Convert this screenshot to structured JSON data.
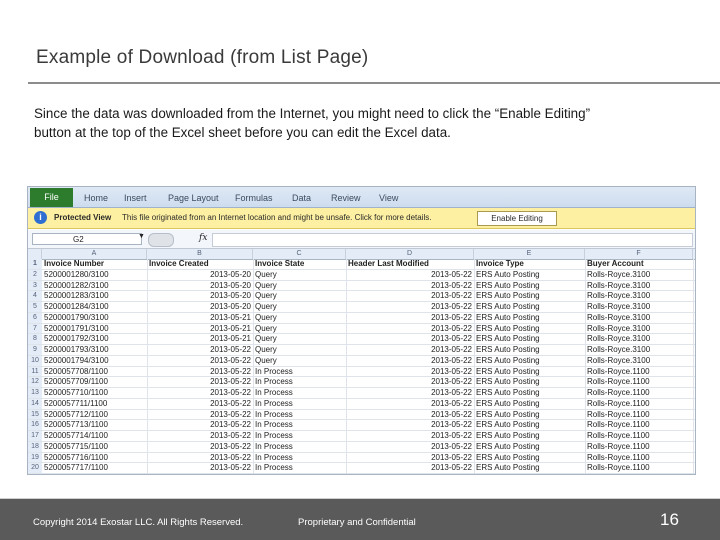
{
  "slide": {
    "title": "Example of Download (from List Page)",
    "intro_line1": "Since the data was downloaded from the Internet, you might need to click the “Enable Editing”",
    "intro_line2": "button at the top of the Excel sheet before you can edit the Excel data."
  },
  "excel": {
    "tabs": [
      "File",
      "Home",
      "Insert",
      "Page Layout",
      "Formulas",
      "Data",
      "Review",
      "View"
    ],
    "protected_view": {
      "icon": "info-icon",
      "title": "Protected View",
      "message": "This file originated from an Internet location and might be unsafe. Click for more details.",
      "button": "Enable Editing"
    },
    "name_box": "G2",
    "fx": "fx",
    "columns": [
      "A",
      "B",
      "C",
      "D",
      "E",
      "F"
    ],
    "header": [
      "Invoice Number",
      "Invoice Created",
      "Invoice State",
      "Header Last Modified",
      "Invoice Type",
      "Buyer Account"
    ],
    "rows": [
      [
        "5200001280/3100",
        "2013-05-20",
        "Query",
        "2013-05-22",
        "ERS Auto Posting",
        "Rolls-Royce.3100"
      ],
      [
        "5200001282/3100",
        "2013-05-20",
        "Query",
        "2013-05-22",
        "ERS Auto Posting",
        "Rolls-Royce.3100"
      ],
      [
        "5200001283/3100",
        "2013-05-20",
        "Query",
        "2013-05-22",
        "ERS Auto Posting",
        "Rolls-Royce.3100"
      ],
      [
        "5200001284/3100",
        "2013-05-20",
        "Query",
        "2013-05-22",
        "ERS Auto Posting",
        "Rolls-Royce.3100"
      ],
      [
        "5200001790/3100",
        "2013-05-21",
        "Query",
        "2013-05-22",
        "ERS Auto Posting",
        "Rolls-Royce.3100"
      ],
      [
        "5200001791/3100",
        "2013-05-21",
        "Query",
        "2013-05-22",
        "ERS Auto Posting",
        "Rolls-Royce.3100"
      ],
      [
        "5200001792/3100",
        "2013-05-21",
        "Query",
        "2013-05-22",
        "ERS Auto Posting",
        "Rolls-Royce.3100"
      ],
      [
        "5200001793/3100",
        "2013-05-22",
        "Query",
        "2013-05-22",
        "ERS Auto Posting",
        "Rolls-Royce.3100"
      ],
      [
        "5200001794/3100",
        "2013-05-22",
        "Query",
        "2013-05-22",
        "ERS Auto Posting",
        "Rolls-Royce.3100"
      ],
      [
        "5200057708/1100",
        "2013-05-22",
        "In Process",
        "2013-05-22",
        "ERS Auto Posting",
        "Rolls-Royce.1100"
      ],
      [
        "5200057709/1100",
        "2013-05-22",
        "In Process",
        "2013-05-22",
        "ERS Auto Posting",
        "Rolls-Royce.1100"
      ],
      [
        "5200057710/1100",
        "2013-05-22",
        "In Process",
        "2013-05-22",
        "ERS Auto Posting",
        "Rolls-Royce.1100"
      ],
      [
        "5200057711/1100",
        "2013-05-22",
        "In Process",
        "2013-05-22",
        "ERS Auto Posting",
        "Rolls-Royce.1100"
      ],
      [
        "5200057712/1100",
        "2013-05-22",
        "In Process",
        "2013-05-22",
        "ERS Auto Posting",
        "Rolls-Royce.1100"
      ],
      [
        "5200057713/1100",
        "2013-05-22",
        "In Process",
        "2013-05-22",
        "ERS Auto Posting",
        "Rolls-Royce.1100"
      ],
      [
        "5200057714/1100",
        "2013-05-22",
        "In Process",
        "2013-05-22",
        "ERS Auto Posting",
        "Rolls-Royce.1100"
      ],
      [
        "5200057715/1100",
        "2013-05-22",
        "In Process",
        "2013-05-22",
        "ERS Auto Posting",
        "Rolls-Royce.1100"
      ],
      [
        "5200057716/1100",
        "2013-05-22",
        "In Process",
        "2013-05-22",
        "ERS Auto Posting",
        "Rolls-Royce.1100"
      ],
      [
        "5200057717/1100",
        "2013-05-22",
        "In Process",
        "2013-05-22",
        "ERS Auto Posting",
        "Rolls-Royce.1100"
      ]
    ]
  },
  "footer": {
    "copyright": "Copyright 2014 Exostar LLC. All Rights Reserved.",
    "confidential": "Proprietary and Confidential",
    "page": "16"
  }
}
